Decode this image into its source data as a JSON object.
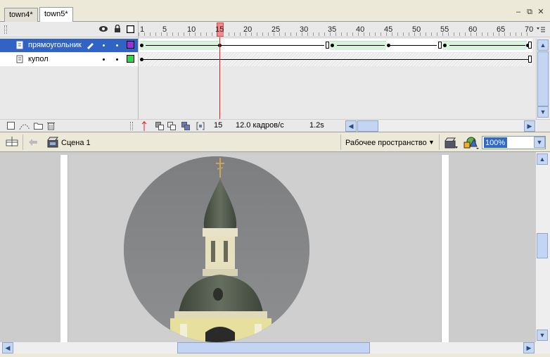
{
  "tabs": [
    {
      "label": "town4*"
    },
    {
      "label": "town5*"
    }
  ],
  "window_buttons": {
    "minimize": "–",
    "restore": "⧉",
    "close": "✕"
  },
  "timeline": {
    "ruler": [
      "1",
      "5",
      "10",
      "15",
      "20",
      "25",
      "30",
      "35",
      "40",
      "45",
      "50",
      "55",
      "60",
      "65",
      "70"
    ],
    "layers": [
      {
        "name": "прямоугольник",
        "selected": true,
        "color": "#9b30d8"
      },
      {
        "name": "купол",
        "selected": false,
        "color": "#2ad84a"
      }
    ],
    "footer": {
      "current_frame": "15",
      "fps": "12.0 кадров/с",
      "elapsed": "1.2s"
    }
  },
  "editbar": {
    "scene": "Сцена 1",
    "workspace": "Рабочее пространство",
    "zoom": "100%"
  },
  "colors": {
    "selection": "#3163c5",
    "playhead": "#e02020",
    "tween": "#d8f4dc"
  }
}
